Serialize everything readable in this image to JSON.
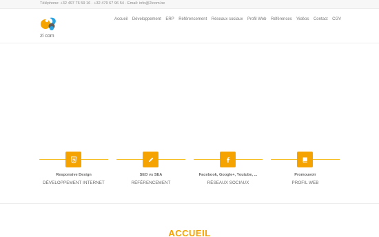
{
  "topbar": {
    "contact_line": "Téléphone: +32 497 76 59 16 · +32 479 67 96 54 · Email: info@2icom.be"
  },
  "logo": {
    "text": "2i com",
    "colors": {
      "orange": "#f5a300",
      "blue": "#2aa4e0",
      "dark": "#5c5c5c"
    }
  },
  "nav": {
    "items": [
      {
        "label": "Accueil"
      },
      {
        "label": "Développement"
      },
      {
        "label": "ERP"
      },
      {
        "label": "Référencement"
      },
      {
        "label": "Réseaux sociaux"
      },
      {
        "label": "Profil Web"
      },
      {
        "label": "Références"
      },
      {
        "label": "Vidéos"
      },
      {
        "label": "Contact"
      },
      {
        "label": "CGV"
      }
    ]
  },
  "features": [
    {
      "icon": "html5-icon",
      "title": "Responsive Design",
      "subtitle": "DÉVELOPPEMENT INTERNET"
    },
    {
      "icon": "pencil-icon",
      "title": "SEO vs SEA",
      "subtitle": "RÉFÉRENCEMENT"
    },
    {
      "icon": "facebook-icon",
      "title": "Facebook, Google+, Youtube, ...",
      "subtitle": "RÉSEAUX SOCIAUX"
    },
    {
      "icon": "book-icon",
      "title": "Promouvoir",
      "subtitle": "PROFIL WEB"
    }
  ],
  "main": {
    "section_title": "ACCUEIL"
  },
  "colors": {
    "accent": "#f5a300",
    "text": "#666666",
    "topbar_bg": "#f7f7f7"
  }
}
